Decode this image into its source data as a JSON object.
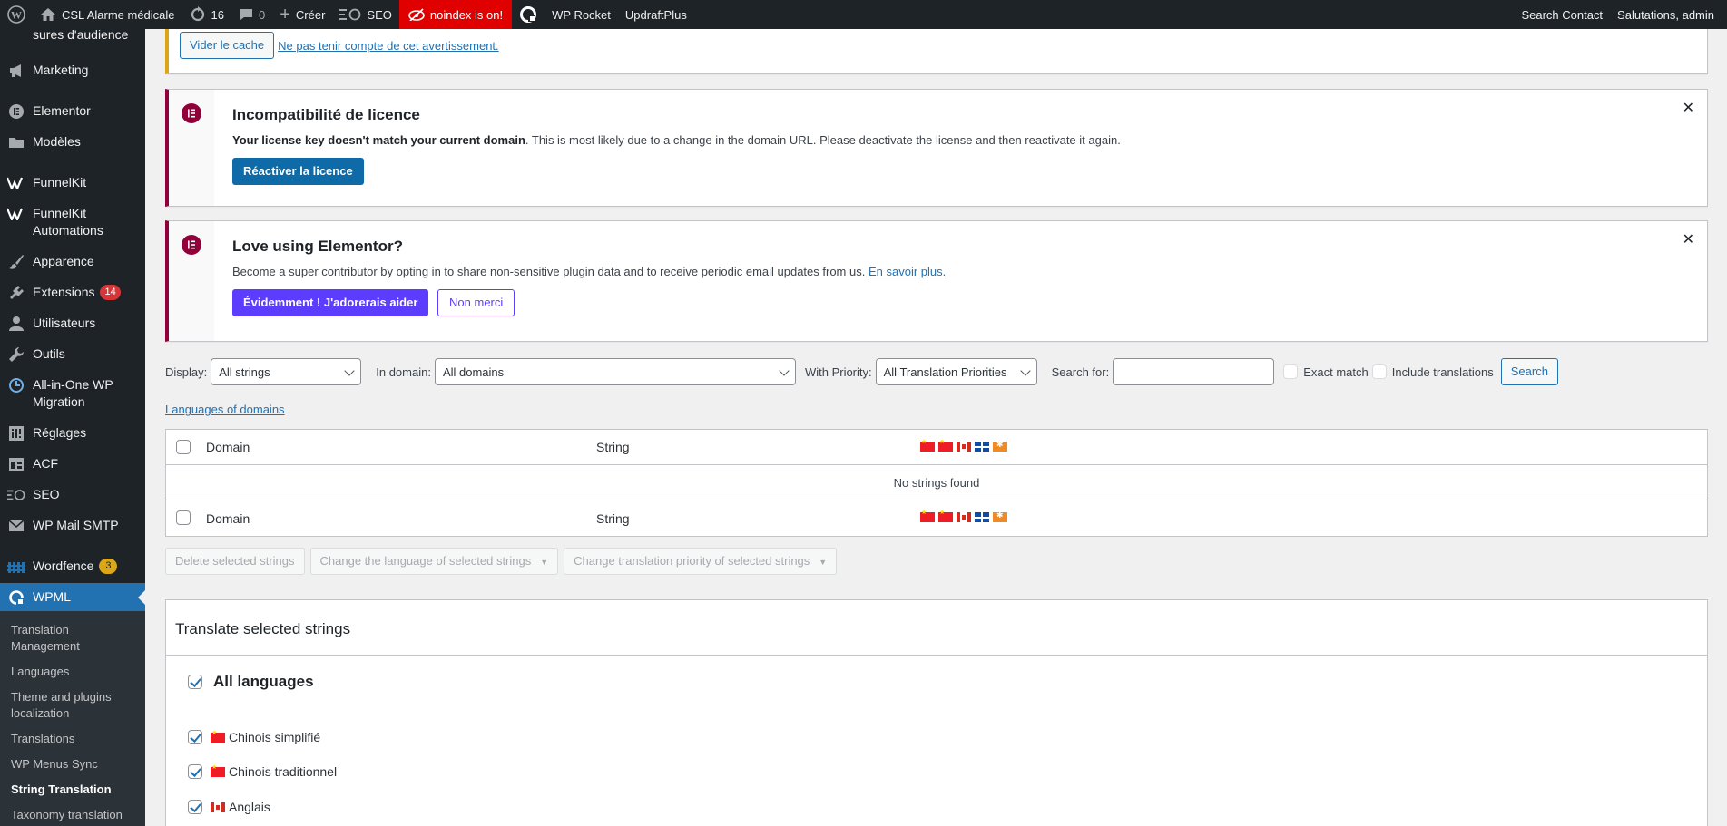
{
  "adminbar": {
    "site_name": "CSL Alarme médicale",
    "updates_count": "16",
    "comments_count": "0",
    "create_label": "Créer",
    "seo_label": "SEO",
    "noindex_label": "noindex is on!",
    "wprocket_label": "WP Rocket",
    "updraft_label": "UpdraftPlus",
    "search_contact_label": "Search Contact",
    "greeting": "Salutations, admin"
  },
  "sidebar": {
    "items": [
      {
        "label": "sures d'audience",
        "icon": ""
      },
      {
        "label": "Marketing",
        "icon": "megaphone-icon"
      },
      {
        "label": "Elementor",
        "icon": "elementor-icon"
      },
      {
        "label": "Modèles",
        "icon": "folder-icon"
      },
      {
        "label": "FunnelKit",
        "icon": "funnelkit-icon"
      },
      {
        "label": "FunnelKit Automations",
        "icon": "funnelkit-icon"
      },
      {
        "label": "Apparence",
        "icon": "brush-icon"
      },
      {
        "label": "Extensions",
        "icon": "plugin-icon",
        "badge": "14"
      },
      {
        "label": "Utilisateurs",
        "icon": "user-icon"
      },
      {
        "label": "Outils",
        "icon": "wrench-icon"
      },
      {
        "label": "All-in-One WP Migration",
        "icon": "migration-icon"
      },
      {
        "label": "Réglages",
        "icon": "settings-icon"
      },
      {
        "label": "ACF",
        "icon": "acf-icon"
      },
      {
        "label": "SEO",
        "icon": "seo-icon"
      },
      {
        "label": "WP Mail SMTP",
        "icon": "mail-icon"
      },
      {
        "label": "Wordfence",
        "icon": "wordfence-icon",
        "badge": "3"
      },
      {
        "label": "WPML",
        "icon": "wpml-icon"
      }
    ],
    "submenu": [
      "Translation Management",
      "Languages",
      "Theme and plugins localization",
      "Translations",
      "WP Menus Sync",
      "String Translation",
      "Taxonomy translation"
    ]
  },
  "cache_notice": {
    "button": "Vider le cache",
    "link": "Ne pas tenir compte de cet avertissement."
  },
  "license_notice": {
    "title": "Incompatibilité de licence",
    "text_bold": "Your license key doesn't match your current domain",
    "text_rest": ". This is most likely due to a change in the domain URL. Please deactivate the license and then reactivate it again.",
    "button": "Réactiver la licence",
    "close": "✕"
  },
  "elementor_notice": {
    "title": "Love using Elementor?",
    "text": "Become a super contributor by opting in to share non-sensitive plugin data and to receive periodic email updates from us.",
    "link": "En savoir plus.",
    "primary_button": "Évidemment ! J'adorerais aider",
    "secondary_button": "Non merci",
    "close": "✕"
  },
  "filters": {
    "display_label": "Display:",
    "display_value": "All strings",
    "domain_label": "In domain:",
    "domain_value": "All domains",
    "priority_label": "With Priority:",
    "priority_value": "All Translation Priorities",
    "search_label": "Search for:",
    "exact_match_label": "Exact match",
    "include_translations_label": "Include translations",
    "search_button": "Search"
  },
  "languages_of_domains_link": "Languages of domains",
  "table": {
    "col_domain": "Domain",
    "col_string": "String",
    "empty_message": "No strings found"
  },
  "bulk_actions": {
    "delete": "Delete selected strings",
    "change_language": "Change the language of selected strings",
    "change_priority": "Change translation priority of selected strings"
  },
  "translate_panel": {
    "title": "Translate selected strings",
    "all_languages": "All languages",
    "languages": [
      {
        "name": "Chinois simplifié",
        "flag": "cn-flag-icon"
      },
      {
        "name": "Chinois traditionnel",
        "flag": "cn-flag-icon"
      },
      {
        "name": "Anglais",
        "flag": "ca-flag-icon"
      }
    ]
  },
  "colors": {
    "admin_bar": "#1d2327",
    "accent_blue": "#2271b1",
    "elementor_red": "#92003b",
    "elementor_purple": "#5c3cff",
    "noindex_red": "#e10000"
  }
}
